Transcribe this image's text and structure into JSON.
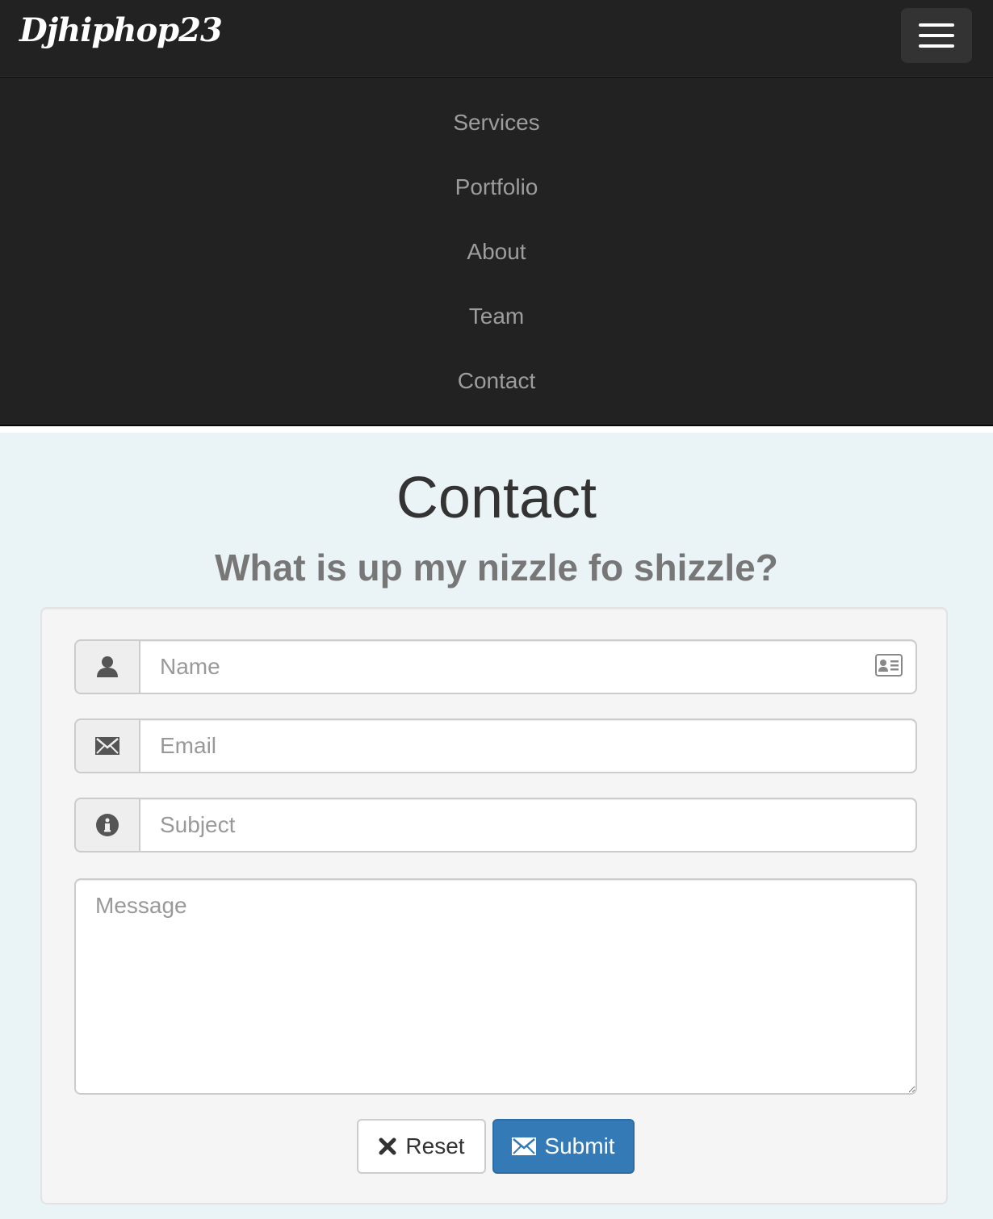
{
  "navbar": {
    "brand": "Djhiphop23",
    "menu_toggle_icon": "hamburger-icon",
    "items": [
      {
        "label": "Services"
      },
      {
        "label": "Portfolio"
      },
      {
        "label": "About"
      },
      {
        "label": "Team"
      },
      {
        "label": "Contact"
      }
    ]
  },
  "contact": {
    "title": "Contact",
    "subtitle": "What is up my nizzle fo shizzle?",
    "form": {
      "name": {
        "placeholder": "Name",
        "value": "",
        "icon": "user-icon",
        "autofill_icon": "contact-card-icon"
      },
      "email": {
        "placeholder": "Email",
        "value": "",
        "icon": "envelope-icon"
      },
      "subject": {
        "placeholder": "Subject",
        "value": "",
        "icon": "info-icon"
      },
      "message": {
        "placeholder": "Message",
        "value": ""
      },
      "reset_label": "Reset",
      "reset_icon": "x-icon",
      "submit_label": "Submit",
      "submit_icon": "envelope-icon"
    }
  },
  "colors": {
    "navbar_bg": "#222222",
    "nav_link": "#9d9d9d",
    "section_bg": "#eaf3f6",
    "primary": "#337ab7"
  }
}
